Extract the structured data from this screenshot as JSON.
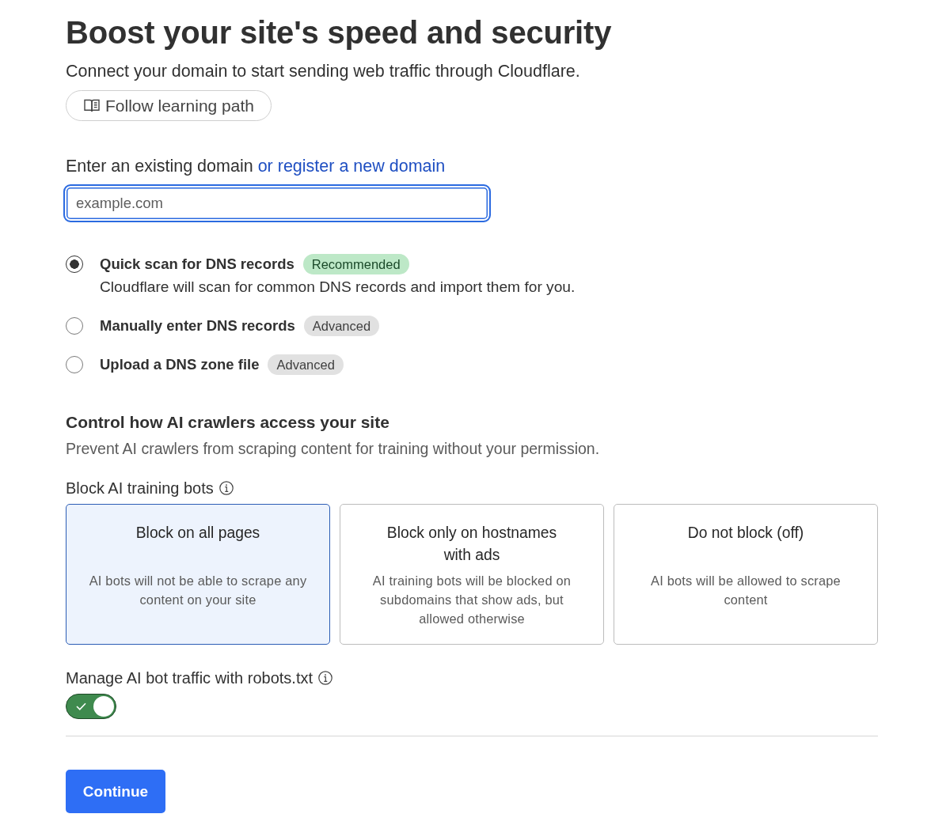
{
  "header": {
    "title": "Boost your site's speed and security",
    "subtitle": "Connect your domain to start sending web traffic through Cloudflare.",
    "learning_button": "Follow learning path"
  },
  "domain": {
    "label": "Enter an existing domain",
    "link": "or register a new domain",
    "placeholder": "example.com",
    "focused": true
  },
  "scan_options": [
    {
      "label": "Quick scan for DNS records",
      "badge": {
        "text": "Recommended",
        "kind": "recommended"
      },
      "description": "Cloudflare will scan for common DNS records and import them for you.",
      "selected": true
    },
    {
      "label": "Manually enter DNS records",
      "badge": {
        "text": "Advanced",
        "kind": "advanced"
      },
      "selected": false
    },
    {
      "label": "Upload a DNS zone file",
      "badge": {
        "text": "Advanced",
        "kind": "advanced"
      },
      "selected": false
    }
  ],
  "ai_crawlers": {
    "title": "Control how AI crawlers access your site",
    "description": "Prevent AI crawlers from scraping content for training without your permission.",
    "block_label": "Block AI training bots",
    "block_options": [
      {
        "title": "Block on all pages",
        "description": "AI bots will not be able to scrape any content on your site",
        "selected": true
      },
      {
        "title": "Block only on hostnames with ads",
        "description": "AI training bots will be blocked on subdomains that show ads, but allowed otherwise",
        "selected": false
      },
      {
        "title": "Do not block (off)",
        "description": "AI bots will be allowed to scrape content",
        "selected": false
      }
    ],
    "robots_label": "Manage AI bot traffic with robots.txt",
    "robots_toggle": {
      "on": true
    }
  },
  "continue_button": "Continue"
}
